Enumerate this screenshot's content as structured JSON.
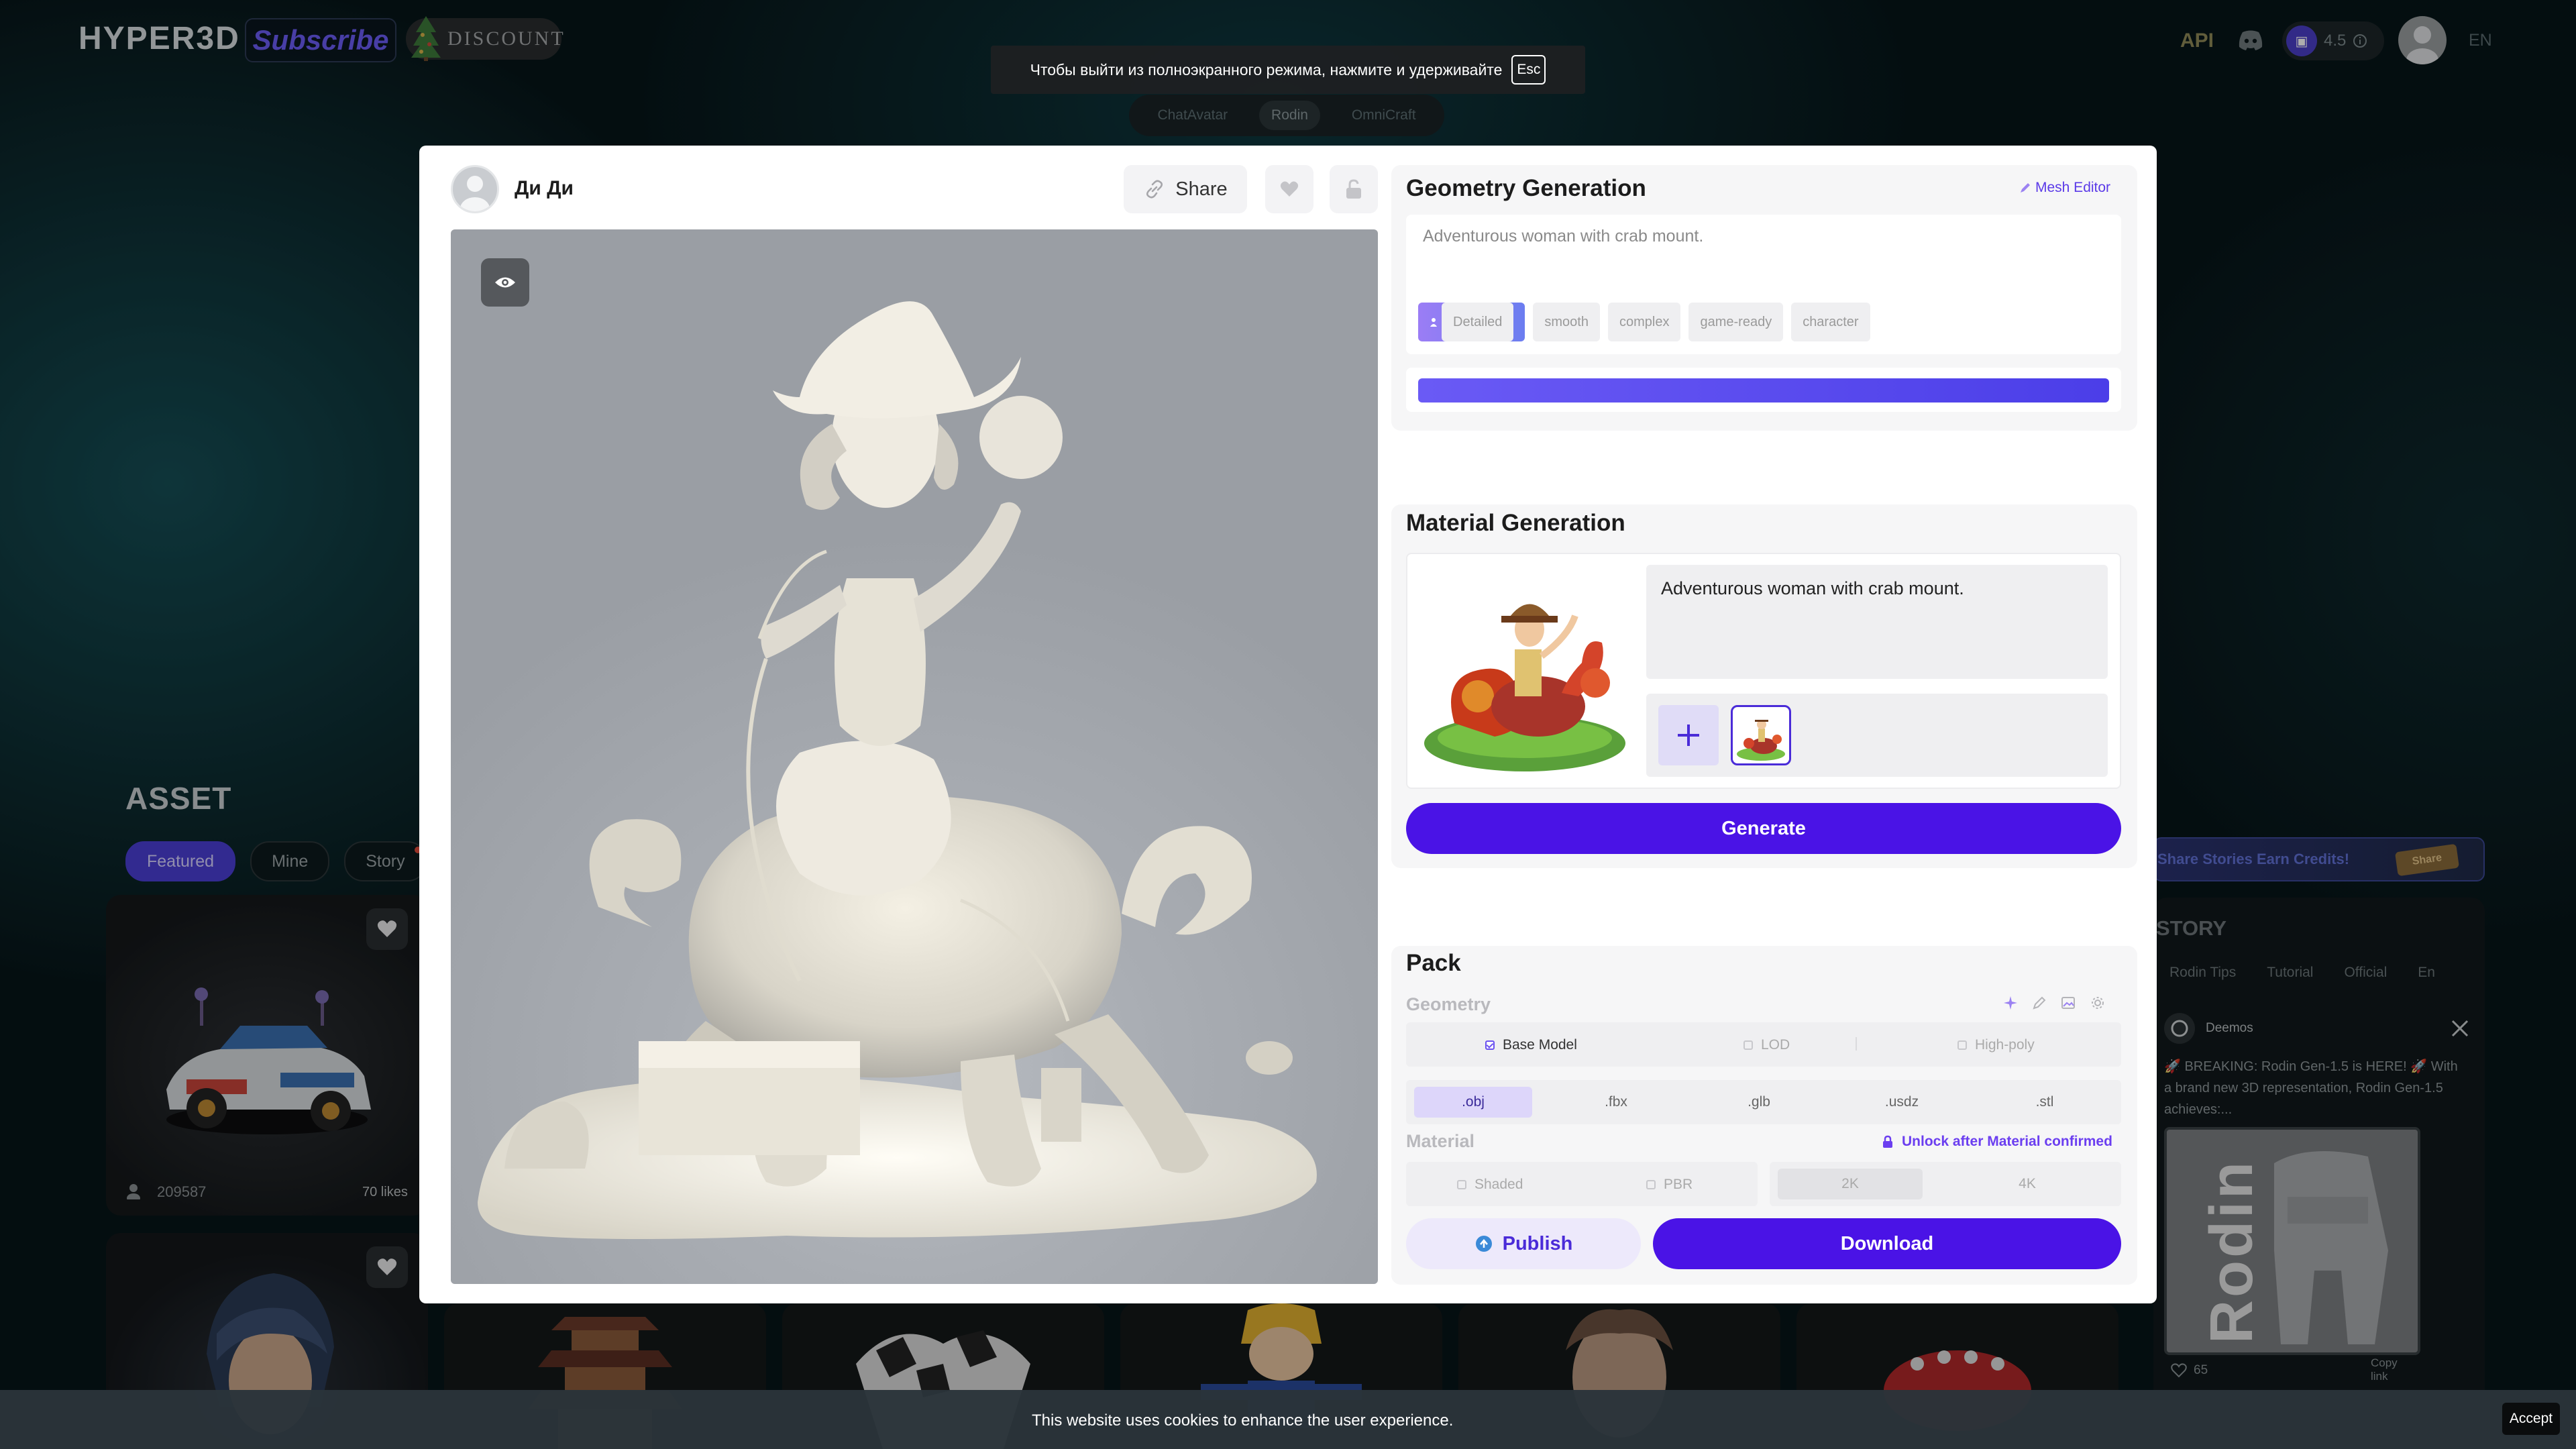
{
  "header": {
    "logo": "HYPER3D",
    "subscribe": "Subscribe",
    "discount": "DISCOUNT",
    "api": "API",
    "credits": "4.5",
    "lang": "EN"
  },
  "fullscreen_notice": {
    "text": "Чтобы выйти из полноэкранного режима, нажмите и удерживайте",
    "key": "Esc"
  },
  "product_tabs": [
    {
      "label": "ChatAvatar"
    },
    {
      "label": "Rodin"
    },
    {
      "label": "OmniCraft"
    }
  ],
  "gallery": {
    "title": "ASSET",
    "filters": [
      {
        "label": "Featured"
      },
      {
        "label": "Mine"
      },
      {
        "label": "Story"
      }
    ],
    "card1": {
      "user": "209587",
      "likes": "70 likes"
    }
  },
  "story_sidebar": {
    "promo": "Share Stories Earn Credits!",
    "promo_btn": "Share",
    "title": "STORY",
    "tabs": [
      {
        "label": "Rodin Tips"
      },
      {
        "label": "Tutorial"
      },
      {
        "label": "Official"
      },
      {
        "label": "En"
      }
    ],
    "author": "Deemos",
    "post_text": "🚀 BREAKING: Rodin Gen-1.5 is HERE! 🚀 With a brand new 3D representation, Rodin Gen-1.5 achieves:...",
    "image_text": "Rodin",
    "likes": "65",
    "copy_link": "Copy link"
  },
  "modal": {
    "user_name": "Ди Ди",
    "share": "Share",
    "geometry": {
      "title": "Geometry Generation",
      "mesh_editor": "Mesh Editor",
      "prompt": "Adventurous woman with crab mount.",
      "tags": [
        {
          "label": "Detailed"
        },
        {
          "label": "smooth"
        },
        {
          "label": "complex"
        },
        {
          "label": "game-ready"
        },
        {
          "label": "character"
        }
      ],
      "progress": 1.0
    },
    "material": {
      "title": "Material Generation",
      "prompt": "Adventurous woman with crab mount.",
      "generate": "Generate"
    },
    "pack": {
      "title": "Pack",
      "geometry_label": "Geometry",
      "geometry_options": [
        {
          "label": "Base Model",
          "checked": true
        },
        {
          "label": "LOD",
          "checked": false
        },
        {
          "label": "High-poly",
          "checked": false
        }
      ],
      "formats": [
        {
          "label": ".obj",
          "selected": true
        },
        {
          "label": ".fbx"
        },
        {
          "label": ".glb"
        },
        {
          "label": ".usdz"
        },
        {
          "label": ".stl"
        }
      ],
      "material_label": "Material",
      "unlock": "Unlock after Material confirmed",
      "material_options": [
        {
          "label": "Shaded"
        },
        {
          "label": "PBR"
        }
      ],
      "resolutions": [
        {
          "label": "2K",
          "selected": true
        },
        {
          "label": "4K"
        }
      ],
      "publish": "Publish",
      "download": "Download"
    }
  },
  "cookie": {
    "text": "This website uses cookies to enhance the user experience.",
    "accept": "Accept"
  },
  "colors": {
    "accent": "#4a13e6",
    "accent_light": "#6b52f0",
    "brand_purple": "#6a5cf5"
  }
}
